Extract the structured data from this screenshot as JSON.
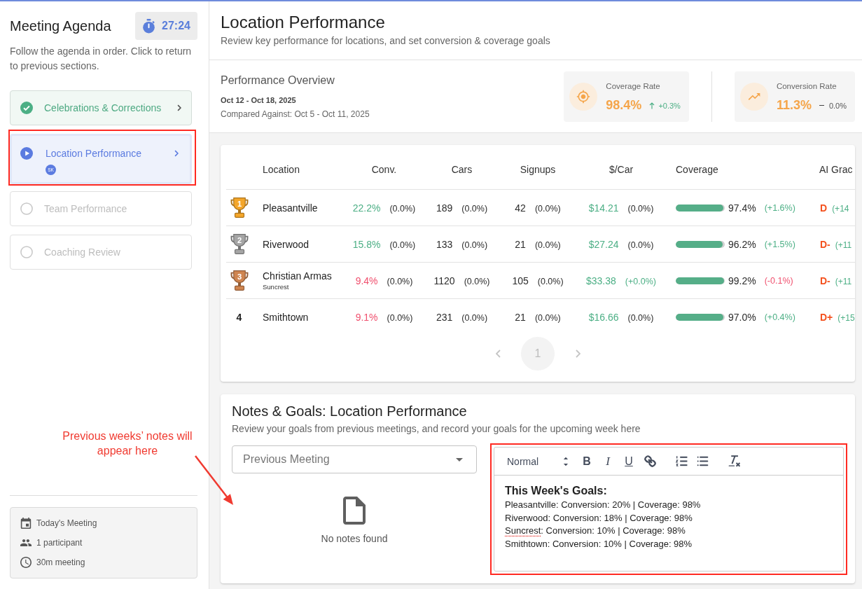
{
  "sidebar": {
    "title": "Meeting Agenda",
    "timer": "27:24",
    "description": "Follow the agenda in order. Click to return to previous sections.",
    "agenda_items": [
      {
        "label": "Celebrations & Corrections",
        "kind": "completed",
        "selected": false,
        "highlighted": false
      },
      {
        "label": "Location Performance",
        "kind": "current",
        "selected": true,
        "highlighted": true,
        "participants": [
          "SK"
        ]
      },
      {
        "label": "Team Performance",
        "kind": "upcoming",
        "selected": false,
        "highlighted": false
      },
      {
        "label": "Coaching Review",
        "kind": "upcoming",
        "selected": false,
        "highlighted": false
      }
    ],
    "meeting_info": [
      {
        "kind": "calendar",
        "label": "Today's Meeting"
      },
      {
        "kind": "participants",
        "label": "1 participant"
      },
      {
        "kind": "duration",
        "label": "30m meeting"
      }
    ]
  },
  "header": {
    "title": "Location Performance",
    "subtitle": "Review key performance for locations, and set conversion & coverage goals"
  },
  "overview": {
    "title": "Performance Overview",
    "date_range": "Oct 12 - Oct 18, 2025",
    "compared": "Compared Against: Oct 5 - Oct 11, 2025",
    "stats": [
      {
        "kind": "coverage",
        "label": "Coverage Rate",
        "value": "98.4%",
        "rising": true,
        "falling": false,
        "change": {
          "text": "+0.3%",
          "color": "#4caf85"
        }
      },
      {
        "kind": "conversion",
        "label": "Conversion Rate",
        "value": "11.3%",
        "rising": false,
        "falling": false,
        "change": {
          "text": "0.0%"
        }
      }
    ]
  },
  "table": {
    "columns": [
      "Location",
      "Conv.",
      "Cars",
      "Signups",
      "$/Car",
      "Coverage",
      "AI Grac"
    ],
    "rows": [
      {
        "rank": "1",
        "color": "#f4a62a",
        "location": "Pleasantville",
        "conv": {
          "value": {
            "text": "22.2%",
            "color": "#4caf85"
          },
          "delta": {
            "text": "(0.0%)"
          }
        },
        "cars": {
          "value": {
            "text": "189"
          },
          "delta": {
            "text": "(0.0%)"
          }
        },
        "signups": {
          "value": {
            "text": "42"
          },
          "delta": {
            "text": "(0.0%)"
          }
        },
        "per_car": {
          "value": {
            "text": "$14.21",
            "color": "#4caf85"
          },
          "delta": {
            "text": "(0.0%)"
          }
        },
        "coverage": {
          "level": 0.974,
          "value": {
            "text": "97.4%"
          },
          "delta": {
            "text": "(+1.6%)",
            "color": "#4caf85"
          }
        },
        "grade": {
          "value": {
            "text": "D",
            "color": "#f4511e"
          },
          "delta": {
            "text": "(+14",
            "color": "#4caf85"
          }
        }
      },
      {
        "rank": "2",
        "color": "#a5a5a5",
        "location": "Riverwood",
        "conv": {
          "value": {
            "text": "15.8%",
            "color": "#4caf85"
          },
          "delta": {
            "text": "(0.0%)"
          }
        },
        "cars": {
          "value": {
            "text": "133"
          },
          "delta": {
            "text": "(0.0%)"
          }
        },
        "signups": {
          "value": {
            "text": "21"
          },
          "delta": {
            "text": "(0.0%)"
          }
        },
        "per_car": {
          "value": {
            "text": "$27.24",
            "color": "#4caf85"
          },
          "delta": {
            "text": "(0.0%)"
          }
        },
        "coverage": {
          "level": 0.962,
          "value": {
            "text": "96.2%"
          },
          "delta": {
            "text": "(+1.5%)",
            "color": "#4caf85"
          }
        },
        "grade": {
          "value": {
            "text": "D-",
            "color": "#f4511e"
          },
          "delta": {
            "text": "(+11",
            "color": "#4caf85"
          }
        }
      },
      {
        "rank": "3",
        "color": "#d08550",
        "location": "Christian Armas",
        "sublocation": "Suncrest",
        "conv": {
          "value": {
            "text": "9.4%",
            "color": "#f0506e"
          },
          "delta": {
            "text": "(0.0%)"
          }
        },
        "cars": {
          "value": {
            "text": "1120"
          },
          "delta": {
            "text": "(0.0%)"
          }
        },
        "signups": {
          "value": {
            "text": "105"
          },
          "delta": {
            "text": "(0.0%)"
          }
        },
        "per_car": {
          "value": {
            "text": "$33.38",
            "color": "#4caf85"
          },
          "delta": {
            "text": "(+0.0%)",
            "color": "#4caf85"
          }
        },
        "coverage": {
          "level": 0.992,
          "value": {
            "text": "99.2%"
          },
          "delta": {
            "text": "(-0.1%)",
            "color": "#f0506e"
          }
        },
        "grade": {
          "value": {
            "text": "D-",
            "color": "#f4511e"
          },
          "delta": {
            "text": "(+11",
            "color": "#4caf85"
          }
        }
      },
      {
        "rank": "4",
        "location": "Smithtown",
        "conv": {
          "value": {
            "text": "9.1%",
            "color": "#f0506e"
          },
          "delta": {
            "text": "(0.0%)"
          }
        },
        "cars": {
          "value": {
            "text": "231"
          },
          "delta": {
            "text": "(0.0%)"
          }
        },
        "signups": {
          "value": {
            "text": "21"
          },
          "delta": {
            "text": "(0.0%)"
          }
        },
        "per_car": {
          "value": {
            "text": "$16.66",
            "color": "#4caf85"
          },
          "delta": {
            "text": "(0.0%)"
          }
        },
        "coverage": {
          "level": 0.97,
          "value": {
            "text": "97.0%"
          },
          "delta": {
            "text": "(+0.4%)",
            "color": "#4caf85"
          }
        },
        "grade": {
          "value": {
            "text": "D+",
            "color": "#f4511e"
          },
          "delta": {
            "text": "(+15",
            "color": "#4caf85"
          }
        }
      }
    ],
    "pagination": {
      "previous_disabled": true,
      "next_disabled": true,
      "pages": [
        {
          "label": "1",
          "selected": true
        }
      ]
    }
  },
  "notes": {
    "title": "Notes & Goals: Location Performance",
    "subtitle": "Review your goals from previous meetings, and record your goals for the upcoming week here",
    "previous_meeting": {
      "placeholder": "Previous Meeting"
    },
    "empty_message": "No notes found",
    "editor": {
      "highlighted": true,
      "format": "Normal",
      "toolbar_groups": [
        [
          {
            "kind": "bold",
            "label": "B"
          },
          {
            "kind": "italic",
            "label": "I"
          },
          {
            "kind": "underline",
            "label": "U"
          },
          {
            "kind": "link"
          }
        ],
        [
          {
            "kind": "ordered-list"
          },
          {
            "kind": "bullet-list"
          }
        ],
        [
          {
            "kind": "clear-format"
          }
        ]
      ],
      "heading": "This Week's Goals:",
      "lines": [
        [
          {
            "text": "Pleasantville: Conversion: 20% | Coverage: 98%",
            "misspelled": false
          }
        ],
        [
          {
            "text": "Riverwood: Conversion: 18% | Coverage: 98%",
            "misspelled": false
          }
        ],
        [
          {
            "text": "Suncrest",
            "misspelled": true
          },
          {
            "text": ": Conversion: 10% | Coverage: 98%",
            "misspelled": false
          }
        ],
        [
          {
            "text": "Smithtown: Conversion: 10% | Coverage: 98%",
            "misspelled": false
          }
        ]
      ]
    }
  },
  "annotations": [
    {
      "text": "Previous weeks’ notes will appear here"
    }
  ]
}
